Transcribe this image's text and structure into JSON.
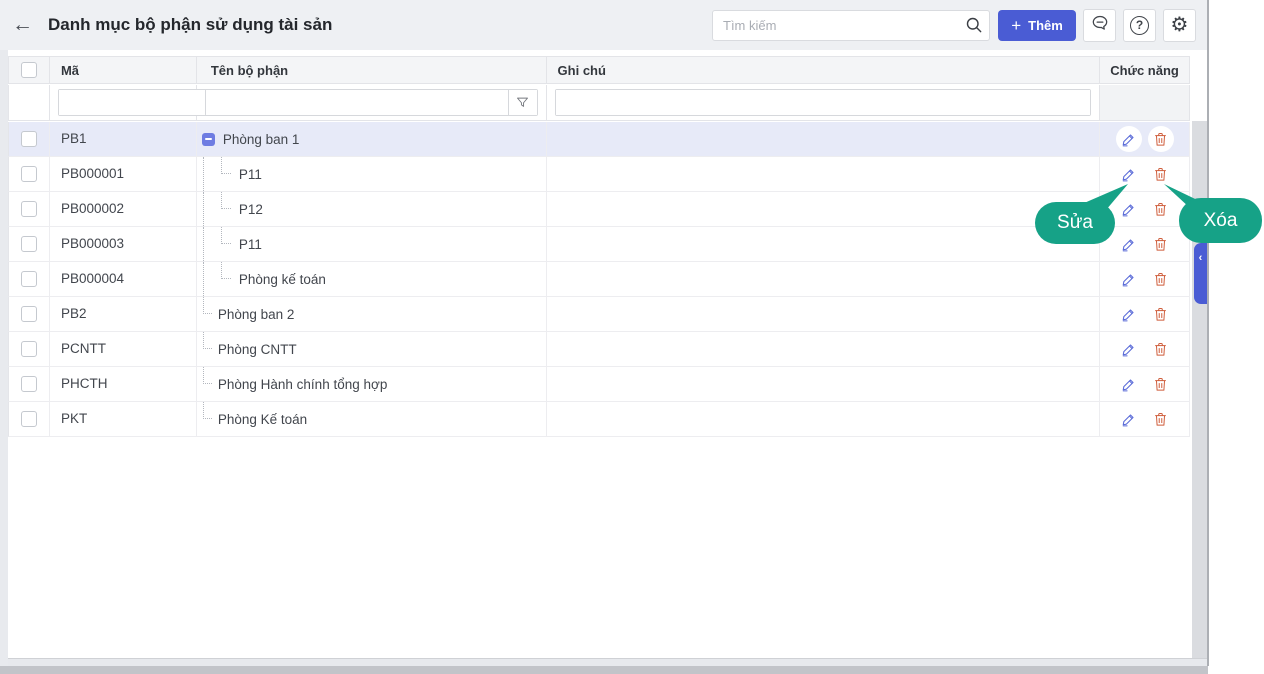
{
  "header": {
    "back_glyph": "←",
    "title": "Danh mục bộ phận sử dụng tài sản",
    "search_placeholder": "Tìm kiếm",
    "add_button_plus": "+",
    "add_button_label": "Thêm",
    "help_glyph": "?",
    "gear_glyph": "⚙"
  },
  "table": {
    "columns": {
      "code": "Mã",
      "name": "Tên bộ phận",
      "note": "Ghi chú",
      "actions": "Chức năng"
    },
    "rows": [
      {
        "code": "PB1",
        "name": "Phòng ban 1",
        "note": "",
        "level": 0,
        "expanded": true,
        "selected": true
      },
      {
        "code": "PB000001",
        "name": "P11",
        "note": "",
        "level": 1
      },
      {
        "code": "PB000002",
        "name": "P12",
        "note": "",
        "level": 1
      },
      {
        "code": "PB000003",
        "name": "P11",
        "note": "",
        "level": 1
      },
      {
        "code": "PB000004",
        "name": "Phòng kế toán",
        "note": "",
        "level": 1
      },
      {
        "code": "PB2",
        "name": "Phòng ban 2",
        "note": "",
        "level": 0
      },
      {
        "code": "PCNTT",
        "name": "Phòng CNTT",
        "note": "",
        "level": 0
      },
      {
        "code": "PHCTH",
        "name": "Phòng Hành chính tổng hợp",
        "note": "",
        "level": 0
      },
      {
        "code": "PKT",
        "name": "Phòng Kế toán",
        "note": "",
        "level": 0
      }
    ]
  },
  "callouts": {
    "edit_label": "Sửa",
    "delete_label": "Xóa"
  },
  "right_handle": {
    "chevron": "‹"
  },
  "colors": {
    "accent_blue": "#4a5cd4",
    "callout_teal": "#16a287",
    "edit_icon": "#5a6bd8",
    "delete_icon": "#cf5c3a",
    "selected_row": "#e7eaf8",
    "collapse_icon": "#6e7ce2",
    "topbar_bg": "#eef0f3",
    "header_row_bg": "#f4f5f7"
  }
}
